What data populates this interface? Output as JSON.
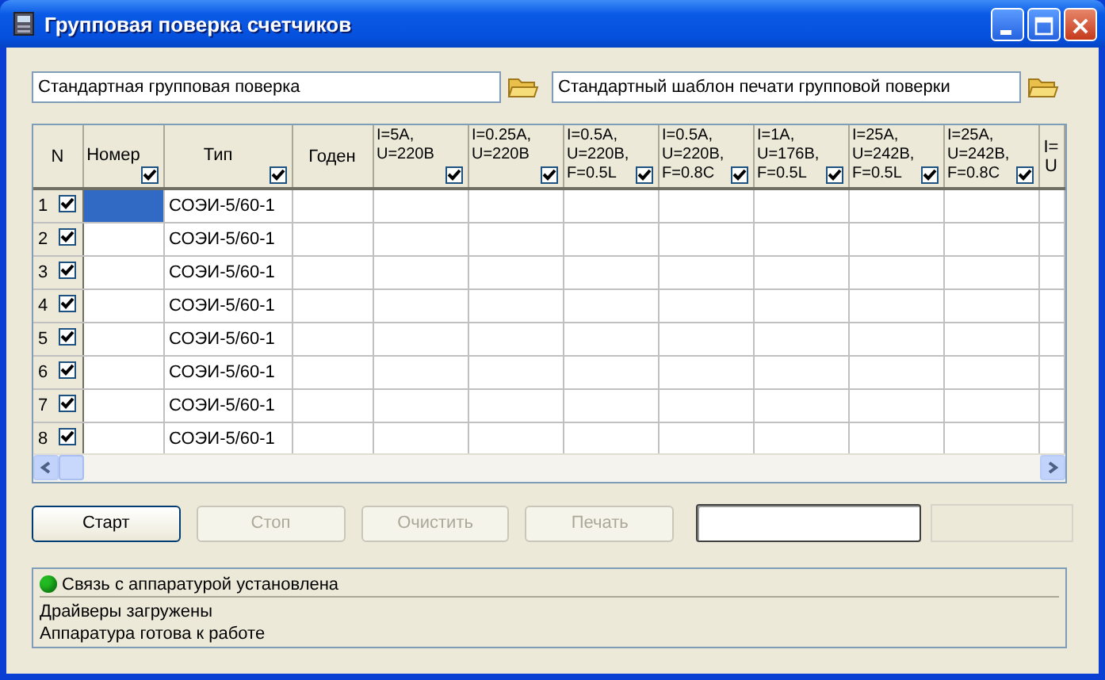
{
  "window": {
    "title": "Групповая поверка счетчиков"
  },
  "files": [
    {
      "value": "Стандартная групповая поверка"
    },
    {
      "value": "Стандартный шаблон печати групповой поверки"
    }
  ],
  "table": {
    "columns": [
      {
        "kind": "label",
        "label": "N"
      },
      {
        "kind": "check",
        "label": "Номер",
        "checked": true
      },
      {
        "kind": "check",
        "label": "Тип",
        "checked": true
      },
      {
        "kind": "label",
        "label": "Годен"
      },
      {
        "kind": "check",
        "label": "I=5A,\nU=220В",
        "checked": true
      },
      {
        "kind": "check",
        "label": "I=0.25A,\nU=220В",
        "checked": true
      },
      {
        "kind": "check",
        "label": "I=0.5A,\nU=220В,\nF=0.5L",
        "checked": true
      },
      {
        "kind": "check",
        "label": "I=0.5A,\nU=220В,\nF=0.8C",
        "checked": true
      },
      {
        "kind": "check",
        "label": "I=1A,\nU=176В,\nF=0.5L",
        "checked": true
      },
      {
        "kind": "check",
        "label": "I=25A,\nU=242В,\nF=0.5L",
        "checked": true
      },
      {
        "kind": "check",
        "label": "I=25A,\nU=242В,\nF=0.8C",
        "checked": true
      },
      {
        "kind": "label",
        "label": "I=\nU"
      }
    ],
    "rows": [
      {
        "n": "1",
        "checked": true,
        "selected": true,
        "type": "СОЭИ-5/60-1"
      },
      {
        "n": "2",
        "checked": true,
        "selected": false,
        "type": "СОЭИ-5/60-1"
      },
      {
        "n": "3",
        "checked": true,
        "selected": false,
        "type": "СОЭИ-5/60-1"
      },
      {
        "n": "4",
        "checked": true,
        "selected": false,
        "type": "СОЭИ-5/60-1"
      },
      {
        "n": "5",
        "checked": true,
        "selected": false,
        "type": "СОЭИ-5/60-1"
      },
      {
        "n": "6",
        "checked": true,
        "selected": false,
        "type": "СОЭИ-5/60-1"
      },
      {
        "n": "7",
        "checked": true,
        "selected": false,
        "type": "СОЭИ-5/60-1"
      },
      {
        "n": "8",
        "checked": true,
        "selected": false,
        "type": "СОЭИ-5/60-1"
      }
    ]
  },
  "buttons": [
    {
      "label": "Старт",
      "disabled": false
    },
    {
      "label": "Стоп",
      "disabled": true
    },
    {
      "label": "Очистить",
      "disabled": true
    },
    {
      "label": "Печать",
      "disabled": true
    }
  ],
  "fields": [
    {
      "disabled": false
    },
    {
      "disabled": true
    }
  ],
  "status": {
    "connection": {
      "text": "Связь с аппаратурой установлена",
      "color": "#22bb22"
    },
    "messages": [
      "Драйверы загружены",
      "Аппаратура готова к работе"
    ]
  }
}
